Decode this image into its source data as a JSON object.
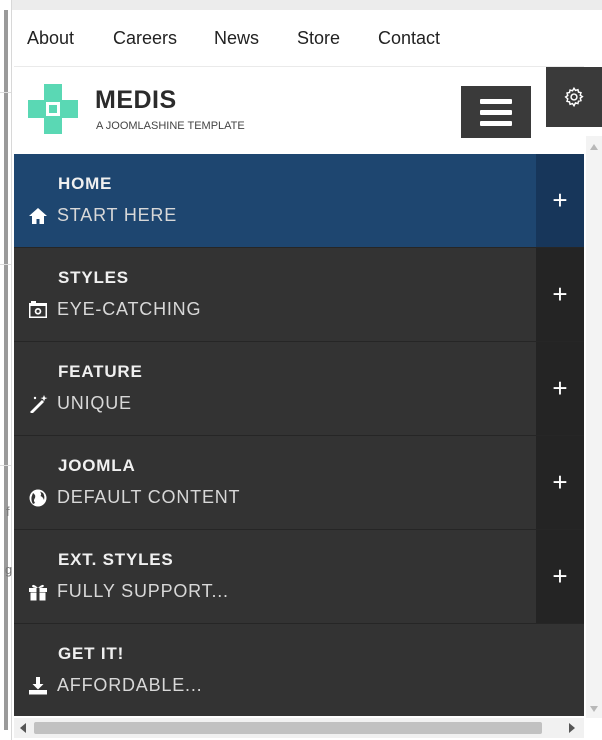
{
  "topnav": {
    "links": [
      {
        "label": "About"
      },
      {
        "label": "Careers"
      },
      {
        "label": "News"
      },
      {
        "label": "Store"
      },
      {
        "label": "Contact"
      }
    ]
  },
  "header": {
    "brand": "MEDIS",
    "tagline": "A JOOMLASHINE TEMPLATE",
    "accent_color": "#5ad8b4",
    "hamburger_icon": "hamburger-icon"
  },
  "settings": {
    "icon": "gear-icon"
  },
  "menu": {
    "items": [
      {
        "title": "HOME",
        "subtitle": "START HERE",
        "icon": "home-icon",
        "expand": "+",
        "active": true
      },
      {
        "title": "STYLES",
        "subtitle": "EYE-CATCHING",
        "icon": "camera-icon",
        "expand": "+"
      },
      {
        "title": "FEATURE",
        "subtitle": "UNIQUE",
        "icon": "magic-wand-icon",
        "expand": "+"
      },
      {
        "title": "JOOMLA",
        "subtitle": "DEFAULT CONTENT",
        "icon": "globe-icon",
        "expand": "+"
      },
      {
        "title": "EXT. STYLES",
        "subtitle": "FULLY SUPPORT...",
        "icon": "gift-icon",
        "expand": "+"
      },
      {
        "title": "GET IT!",
        "subtitle": "AFFORDABLE...",
        "icon": "download-icon"
      }
    ],
    "active_color": "#1e4670",
    "item_color": "#333333"
  },
  "fragments": {
    "f": "f",
    "g": "g"
  }
}
